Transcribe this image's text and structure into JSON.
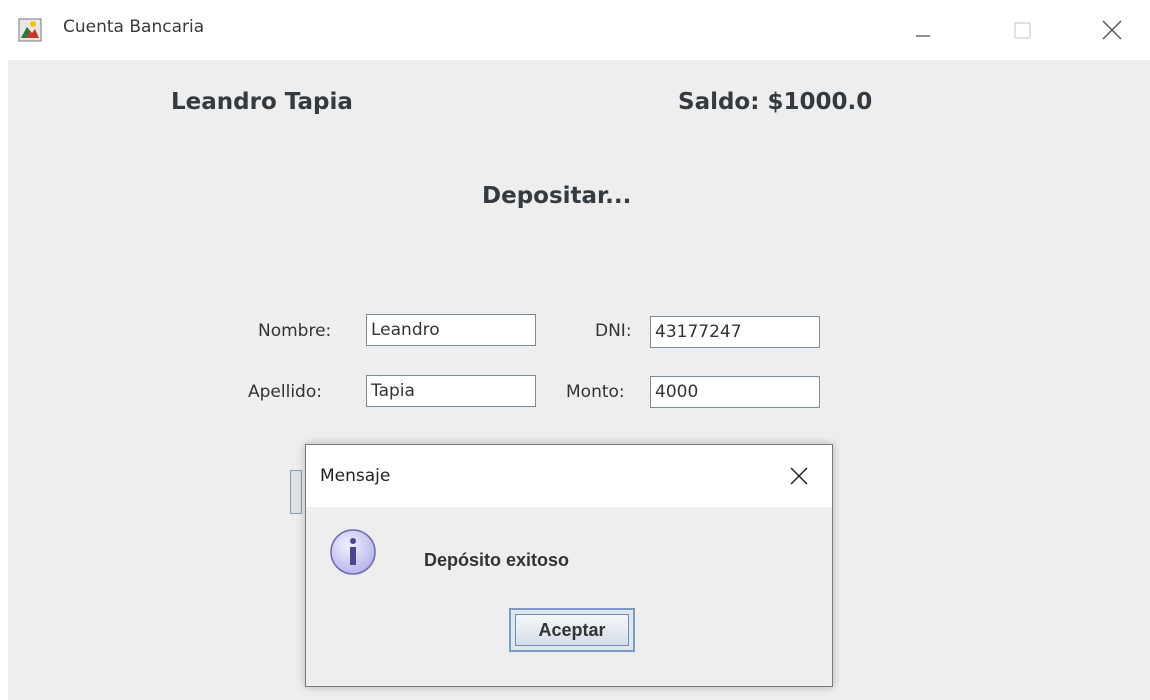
{
  "window": {
    "title": "Cuenta Bancaria",
    "icon": "java-app-icon",
    "controls": [
      "minimize-icon",
      "maximize-icon",
      "close-icon"
    ]
  },
  "account": {
    "holder": "Leandro Tapia",
    "balance": "Saldo: $1000.0"
  },
  "section": {
    "title": "Depositar..."
  },
  "form": {
    "nombre_label": "Nombre:",
    "nombre_value": "Leandro",
    "dni_label": "DNI:",
    "dni_value": "43177247",
    "apellido_label": "Apellido:",
    "apellido_value": "Tapia",
    "monto_label": "Monto:",
    "monto_value": "4000"
  },
  "dialog": {
    "title": "Mensaje",
    "message": "Depósito exitoso",
    "ok_label": "Aceptar",
    "icon": "information-icon"
  },
  "colors": {
    "background": "#eeeeee",
    "accent_border": "#7b9cc4",
    "info_icon": "#c8c6f2"
  }
}
